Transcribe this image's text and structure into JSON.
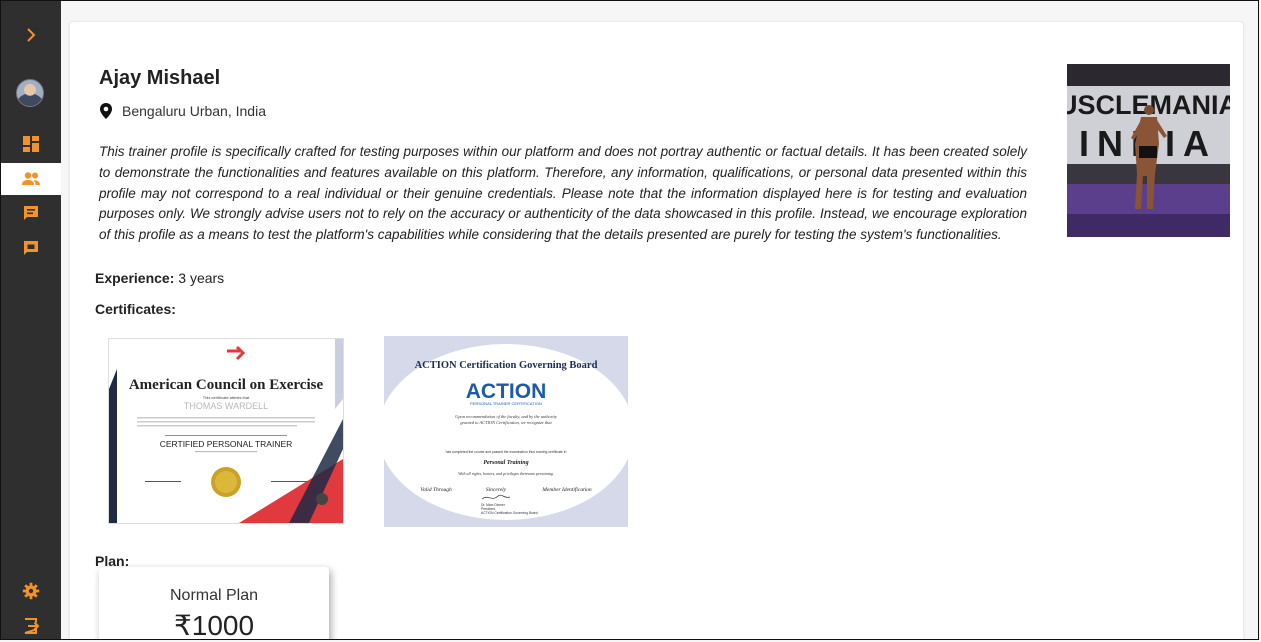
{
  "colors": {
    "sidebar_bg": "#2f2f2f",
    "accent": "#f0932b",
    "card_bg": "#ffffff"
  },
  "sidebar": {
    "items": [
      {
        "name": "expand",
        "icon": "chevron-right-icon"
      },
      {
        "name": "dashboard",
        "icon": "dashboard-icon"
      },
      {
        "name": "trainers",
        "icon": "people-icon",
        "active": true
      },
      {
        "name": "messages",
        "icon": "message-icon"
      },
      {
        "name": "feedback",
        "icon": "feedback-icon"
      },
      {
        "name": "settings",
        "icon": "gear-icon"
      },
      {
        "name": "logout",
        "icon": "logout-icon"
      }
    ]
  },
  "profile": {
    "name": "Ajay Mishael",
    "location": "Bengaluru Urban, India",
    "description": "This trainer profile is specifically crafted for testing purposes within our platform and does not portray authentic or factual details. It has been created solely to demonstrate the functionalities and features available on this platform. Therefore, any information, qualifications, or personal data presented within this profile may not correspond to a real individual or their genuine credentials. Please note that the information displayed here is for testing and evaluation purposes only. We strongly advise users not to rely on the accuracy or authenticity of the data showcased in this profile. Instead, we encourage exploration of this profile as a means to test the platform's capabilities while considering that the details presented are purely for testing the system's functionalities.",
    "experience_label": "Experience:",
    "experience_value": "3 years",
    "photo_text": "USCLEMANIA",
    "photo_text2": "INDIA"
  },
  "certificates": {
    "label": "Certificates:",
    "items": [
      {
        "org": "American Council on Exercise",
        "small1": "This certificate attests that",
        "holder": "THOMAS WARDELL",
        "title": "CERTIFIED PERSONAL TRAINER"
      },
      {
        "header": "ACTION Certification Governing Board",
        "logo": "ACTION",
        "logo_sub": "PERSONAL TRAINER CERTIFICATION",
        "line1": "Upon recommendation of the faculty, and by the authority",
        "line2": "granted to ACTION Certification, we recognize that",
        "line3": "has completed the course and passed the examination thus earning certificate in",
        "field": "Personal Training",
        "rights": "With all rights, honors, and privileges thereunto pertaining.",
        "valid": "Valid Through",
        "sincerely": "Sincerely",
        "member": "Member Identification",
        "signer": "Dr. Marc Dixmer",
        "signer_title": "President,",
        "signer_org": "ACTION Certification Governing Board"
      }
    ]
  },
  "plans": {
    "label": "Plan:",
    "items": [
      {
        "name": "Normal Plan",
        "price": "₹1000"
      }
    ]
  }
}
